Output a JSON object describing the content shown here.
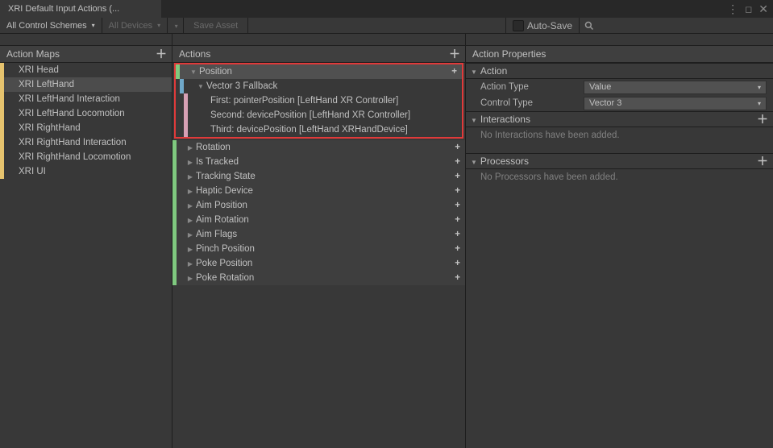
{
  "window": {
    "tab_title": "XRI Default Input Actions (..."
  },
  "toolbar": {
    "control_schemes": "All Control Schemes",
    "devices": "All Devices",
    "save_asset": "Save Asset",
    "auto_save": "Auto-Save"
  },
  "actionMaps": {
    "header": "Action Maps",
    "items": [
      {
        "label": "XRI Head"
      },
      {
        "label": "XRI LeftHand"
      },
      {
        "label": "XRI LeftHand Interaction"
      },
      {
        "label": "XRI LeftHand Locomotion"
      },
      {
        "label": "XRI RightHand"
      },
      {
        "label": "XRI RightHand Interaction"
      },
      {
        "label": "XRI RightHand Locomotion"
      },
      {
        "label": "XRI UI"
      }
    ],
    "selected_index": 1
  },
  "actions": {
    "header": "Actions",
    "rows": [
      {
        "type": "action",
        "label": "Position",
        "expanded": true,
        "selected": true
      },
      {
        "type": "composite",
        "label": "Vector 3 Fallback",
        "expanded": true
      },
      {
        "type": "binding",
        "label": "First: pointerPosition [LeftHand XR Controller]"
      },
      {
        "type": "binding",
        "label": "Second: devicePosition [LeftHand XR Controller]"
      },
      {
        "type": "binding",
        "label": "Third: devicePosition [LeftHand XRHandDevice]"
      },
      {
        "type": "action",
        "label": "Rotation"
      },
      {
        "type": "action",
        "label": "Is Tracked"
      },
      {
        "type": "action",
        "label": "Tracking State"
      },
      {
        "type": "action",
        "label": "Haptic Device"
      },
      {
        "type": "action",
        "label": "Aim Position"
      },
      {
        "type": "action",
        "label": "Aim Rotation"
      },
      {
        "type": "action",
        "label": "Aim Flags"
      },
      {
        "type": "action",
        "label": "Pinch Position"
      },
      {
        "type": "action",
        "label": "Poke Position"
      },
      {
        "type": "action",
        "label": "Poke Rotation"
      }
    ]
  },
  "properties": {
    "header": "Action Properties",
    "action_section": "Action",
    "action_type_label": "Action Type",
    "action_type_value": "Value",
    "control_type_label": "Control Type",
    "control_type_value": "Vector 3",
    "interactions_section": "Interactions",
    "interactions_empty": "No Interactions have been added.",
    "processors_section": "Processors",
    "processors_empty": "No Processors have been added."
  }
}
